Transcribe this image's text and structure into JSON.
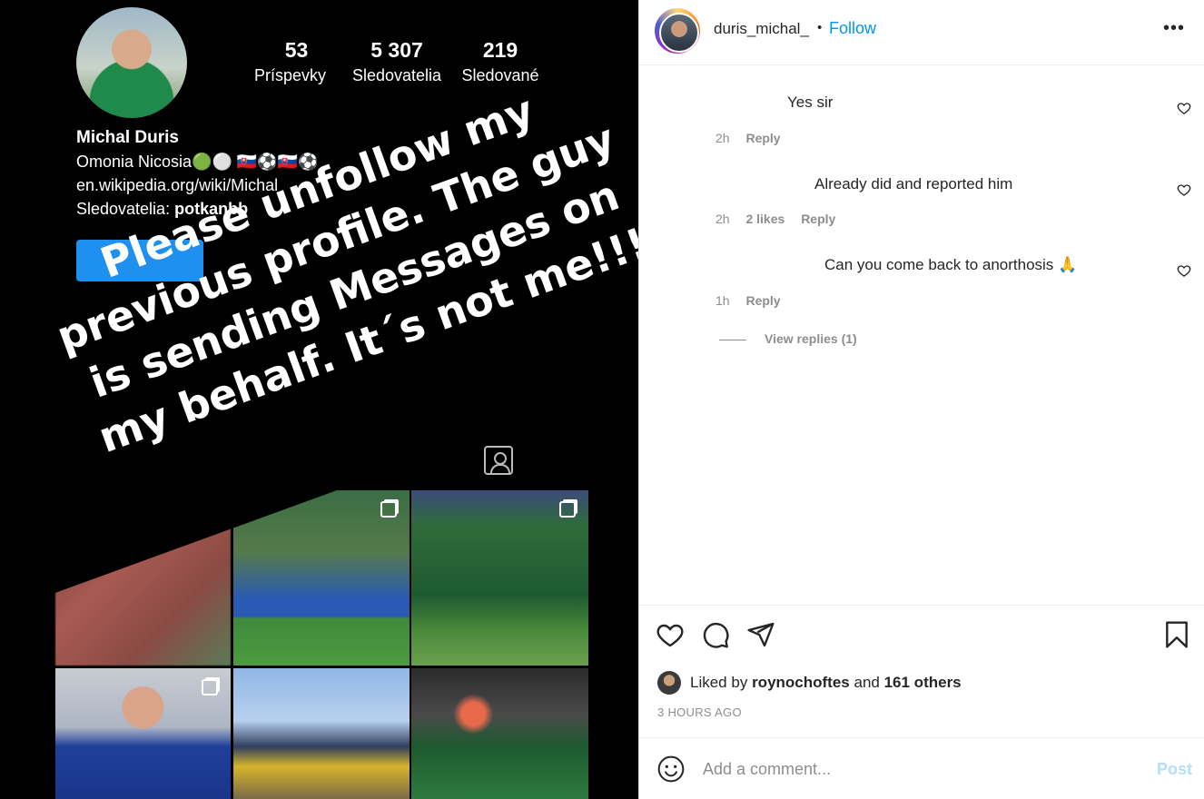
{
  "story": {
    "stats": [
      {
        "number": "53",
        "label": "Príspevky"
      },
      {
        "number": "5 307",
        "label": "Sledovatelia"
      },
      {
        "number": "219",
        "label": "Sledované"
      }
    ],
    "profile_name": "Michal Duris",
    "bio_line1": "Omonia Nicosia🟢⚪ 🇸🇰⚽🇸🇰⚽",
    "bio_line2": "en.wikipedia.org/wiki/Michal",
    "followers_label": "Sledovatelia: ",
    "followers_user": "potkanbb",
    "overlay_lines": [
      "Please unfollow my",
      "previous profile. The guy",
      "is sending Messages on",
      "my behalf. It´s not me!!!"
    ]
  },
  "header": {
    "username": "duris_michal_",
    "separator": "•",
    "follow_label": "Follow",
    "more_label": "•••"
  },
  "comments": [
    {
      "text": "Yes sir",
      "time": "2h",
      "likes": "",
      "reply": "Reply"
    },
    {
      "text": "Already did and reported him",
      "time": "2h",
      "likes": "2 likes",
      "reply": "Reply"
    },
    {
      "text": "Can you come back to anorthosis 🙏",
      "time": "1h",
      "likes": "",
      "reply": "Reply"
    }
  ],
  "view_replies": "View replies (1)",
  "likes": {
    "prefix": "Liked by ",
    "user": "roynochoftes",
    "middle": " and ",
    "others": "161 others"
  },
  "time_ago": "3 HOURS AGO",
  "comment_box": {
    "placeholder": "Add a comment...",
    "post_label": "Post"
  },
  "icons": {
    "like": "heart-icon",
    "comment": "comment-icon",
    "share": "share-icon",
    "save": "bookmark-icon",
    "emoji": "emoji-icon"
  },
  "colors": {
    "accent": "#0095f6",
    "post_disabled": "#b2dffc",
    "muted": "#8e8e8e",
    "text": "#262626"
  }
}
